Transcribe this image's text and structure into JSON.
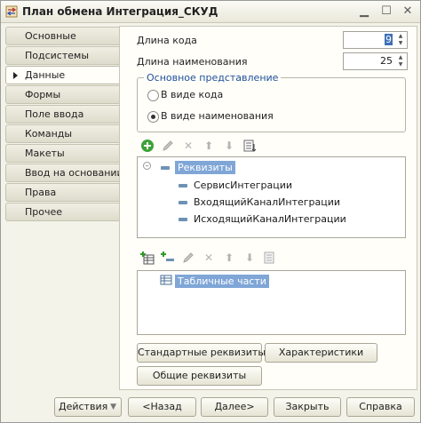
{
  "window": {
    "title": "План обмена Интеграция_СКУД",
    "icons": [
      "exchange-plan-icon",
      "minimize-icon",
      "maximize-icon",
      "close-icon"
    ]
  },
  "tabs": [
    {
      "label": "Основные",
      "active": false
    },
    {
      "label": "Подсистемы",
      "active": false
    },
    {
      "label": "Данные",
      "active": true
    },
    {
      "label": "Формы",
      "active": false
    },
    {
      "label": "Поле ввода",
      "active": false
    },
    {
      "label": "Команды",
      "active": false
    },
    {
      "label": "Макеты",
      "active": false
    },
    {
      "label": "Ввод на основании",
      "active": false
    },
    {
      "label": "Права",
      "active": false
    },
    {
      "label": "Прочее",
      "active": false
    }
  ],
  "data_page": {
    "code_length": {
      "label": "Длина кода",
      "value": "9"
    },
    "name_length": {
      "label": "Длина наименования",
      "value": "25"
    },
    "main_presentation": {
      "title": "Основное представление",
      "options": [
        {
          "label": "В виде кода",
          "selected": false
        },
        {
          "label": "В виде наименования",
          "selected": true
        }
      ]
    },
    "attributes_tree": {
      "root": "Реквизиты",
      "items": [
        "СервисИнтеграции",
        "ВходящийКаналИнтеграции",
        "ИсходящийКаналИнтеграции"
      ]
    },
    "tabular_tree": {
      "root": "Табличные части"
    },
    "buttons": {
      "standard_attributes": "Стандартные реквизиты",
      "characteristics": "Характеристики",
      "common_attributes": "Общие реквизиты"
    }
  },
  "footer": {
    "actions": "Действия",
    "back": "<Назад",
    "next": "Далее>",
    "close": "Закрыть",
    "help": "Справка"
  },
  "colors": {
    "selection": "#7fa6d6",
    "groupbox_title": "#1f4f9a",
    "add_icon": "#3ea13a"
  }
}
